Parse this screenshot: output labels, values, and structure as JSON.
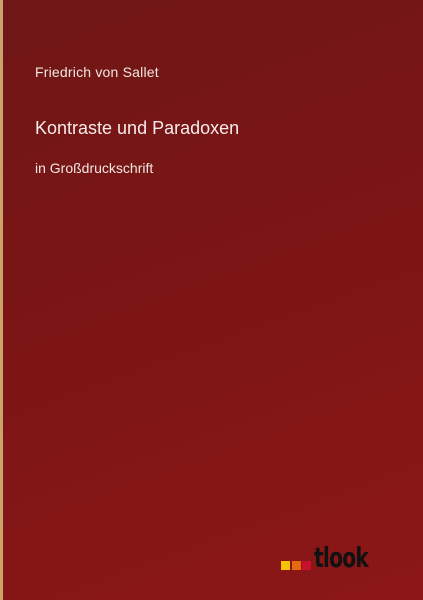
{
  "cover": {
    "author": "Friedrich von Sallet",
    "title": "Kontraste und Paradoxen",
    "subtitle": "in Großdruckschrift"
  },
  "publisher_logo": {
    "text": "tlook",
    "squares": [
      "#f5c400",
      "#e86a10",
      "#c8102e"
    ],
    "icon": "outlook-publisher-logo"
  }
}
